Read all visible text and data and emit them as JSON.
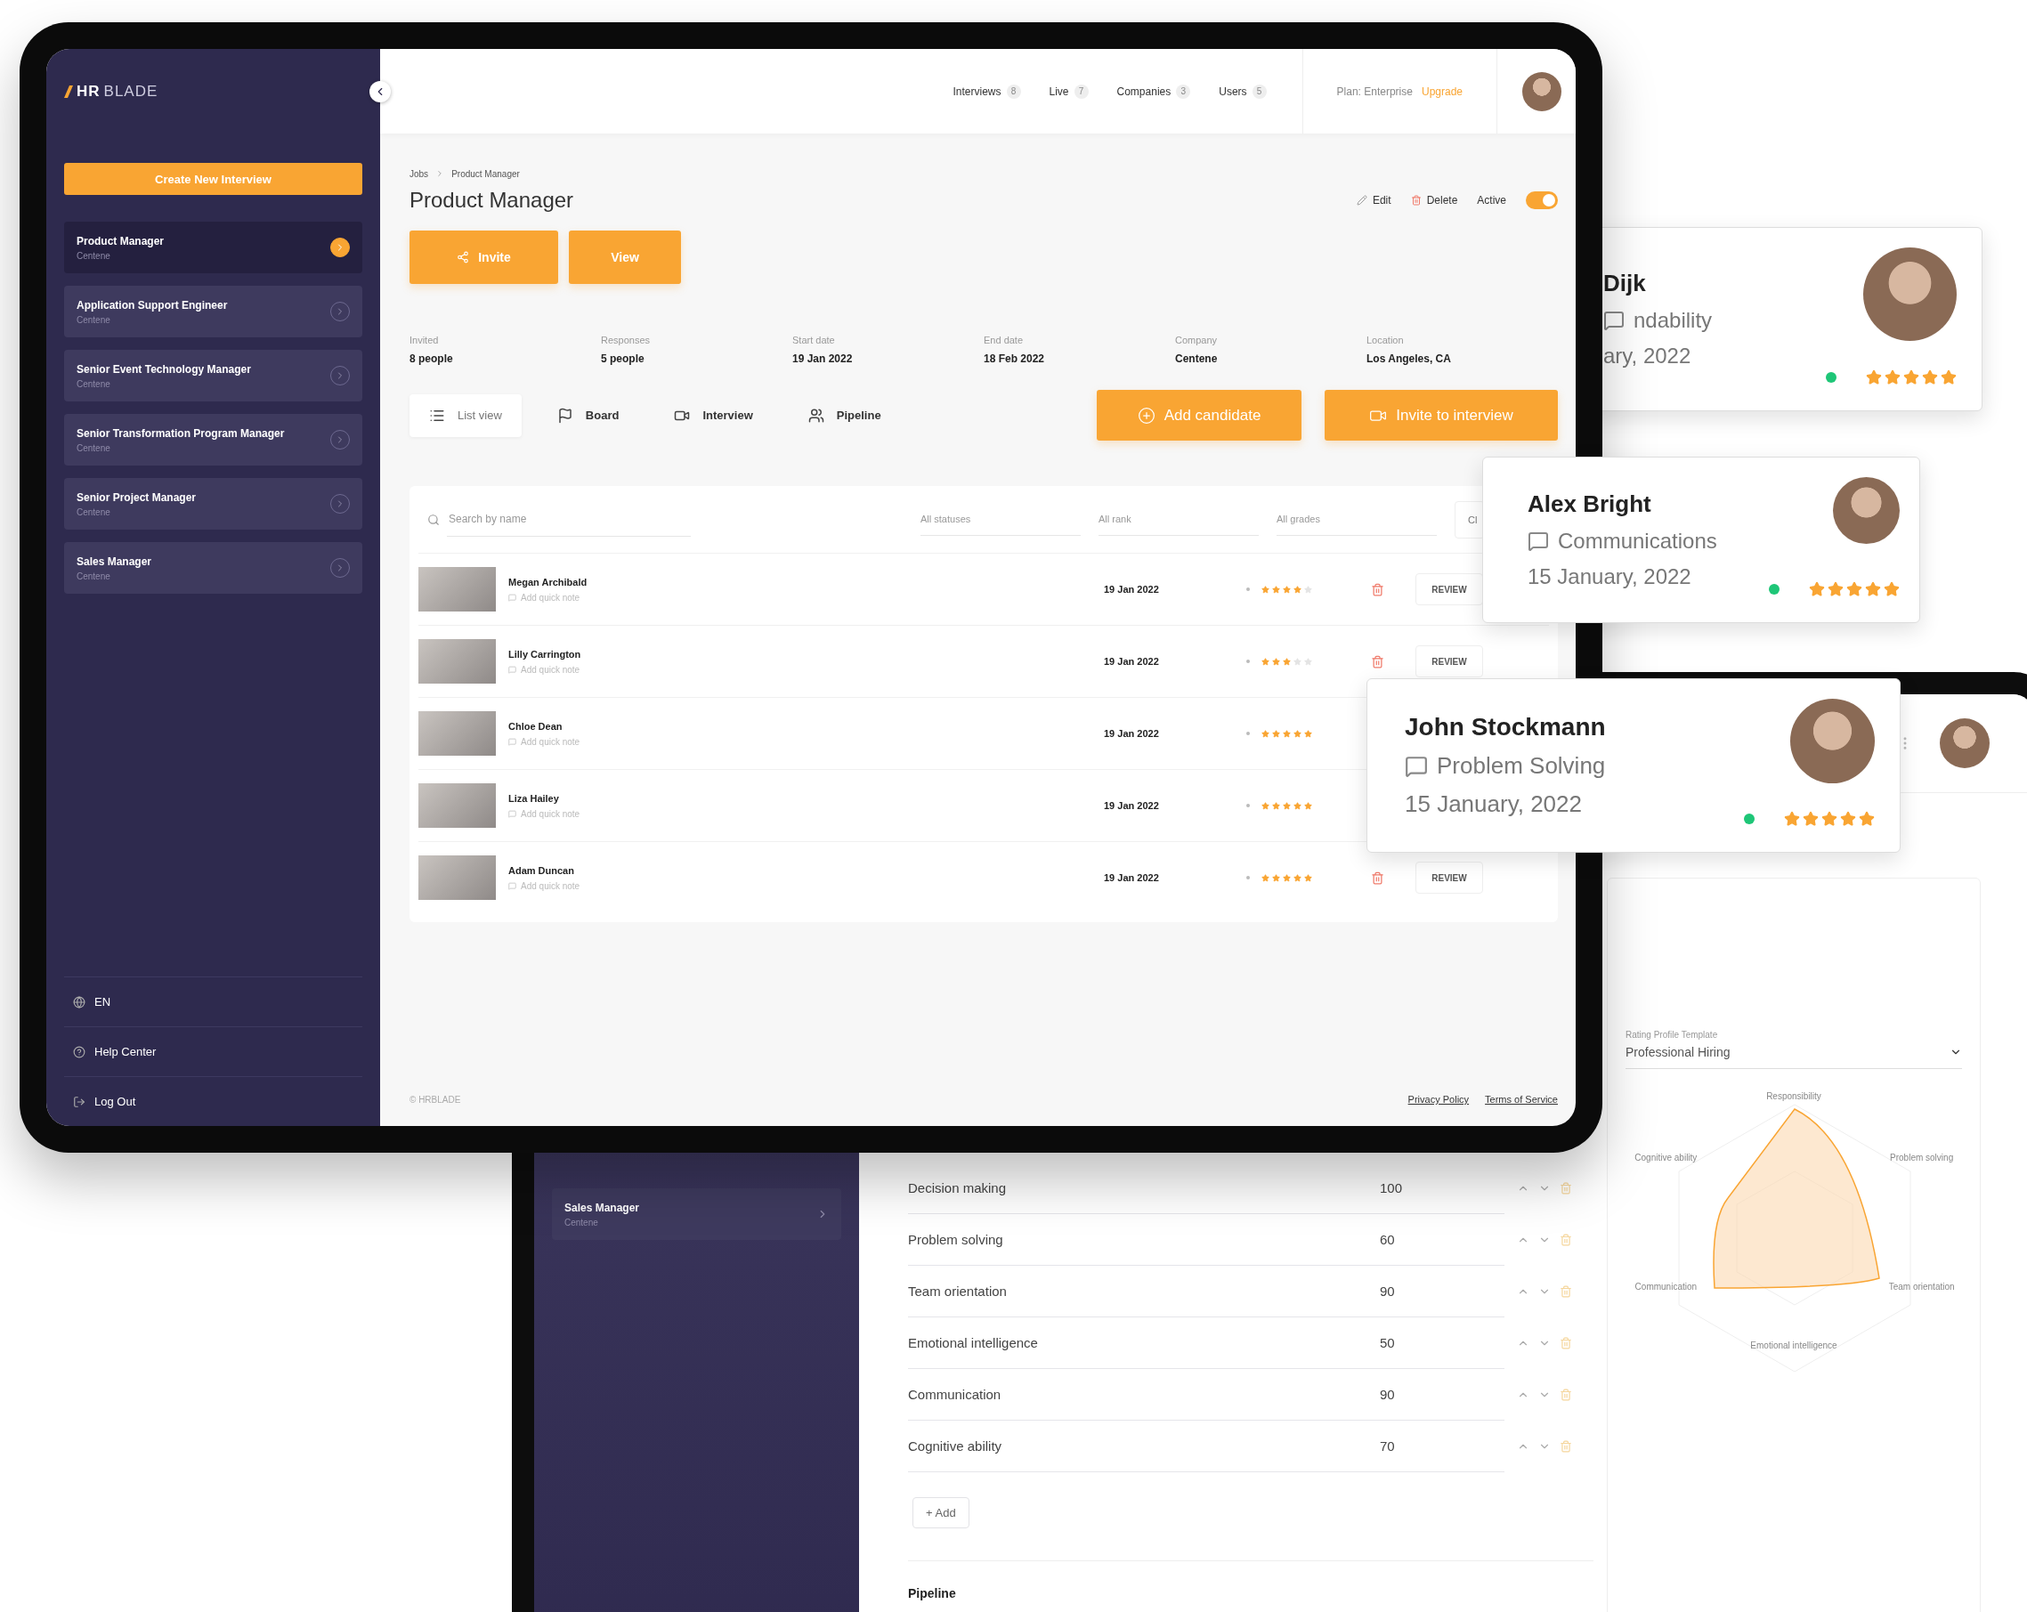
{
  "back": {
    "sidebar_items": [
      {
        "title": "Sales Manager",
        "subtitle": "Centene"
      }
    ],
    "skills": [
      {
        "name": "Decision making",
        "value": "100"
      },
      {
        "name": "Problem solving",
        "value": "60"
      },
      {
        "name": "Team orientation",
        "value": "90"
      },
      {
        "name": "Emotional intelligence",
        "value": "50"
      },
      {
        "name": "Communication",
        "value": "90"
      },
      {
        "name": "Cognitive ability",
        "value": "70"
      }
    ],
    "add_button": "+ Add",
    "section_title": "Pipeline",
    "template": {
      "label": "Rating Profile Template",
      "value": "Professional Hiring"
    },
    "radar_labels": [
      "Responsibility",
      "Problem solving",
      "Team orientation",
      "Emotional intelligence",
      "Communication",
      "Cognitive ability"
    ]
  },
  "front": {
    "sidebar": {
      "logo_bold": "HR",
      "logo_light": "BLADE",
      "create_button": "Create New Interview",
      "items": [
        {
          "title": "Product Manager",
          "subtitle": "Centene",
          "selected": true
        },
        {
          "title": "Application Support Engineer",
          "subtitle": "Centene",
          "selected": false
        },
        {
          "title": "Senior Event Technology Manager",
          "subtitle": "Centene",
          "selected": false
        },
        {
          "title": "Senior Transformation Program Manager",
          "subtitle": "Centene",
          "selected": false
        },
        {
          "title": "Senior Project Manager",
          "subtitle": "Centene",
          "selected": false
        },
        {
          "title": "Sales Manager",
          "subtitle": "Centene",
          "selected": false
        }
      ],
      "footer_items": [
        {
          "kind": "language",
          "label": "EN"
        },
        {
          "kind": "help",
          "label": "Help Center"
        },
        {
          "kind": "logout",
          "label": "Log Out"
        }
      ]
    },
    "top_nav": {
      "links": [
        {
          "label": "Interviews",
          "count": "8"
        },
        {
          "label": "Live",
          "count": "7"
        },
        {
          "label": "Companies",
          "count": "3"
        },
        {
          "label": "Users",
          "count": "5"
        }
      ],
      "plan": "Plan: Enterprise",
      "upgrade": "Upgrade"
    },
    "breadcrumb": [
      "Jobs",
      "Product Manager"
    ],
    "title": "Product Manager",
    "header_buttons": [
      {
        "kind": "invite",
        "label": "Invite"
      },
      {
        "kind": "view",
        "label": "View"
      }
    ],
    "header_actions": [
      {
        "kind": "edit",
        "label": "Edit"
      },
      {
        "kind": "delete",
        "label": "Delete"
      }
    ],
    "active_toggle": {
      "label": "Active",
      "on": true
    },
    "stats": [
      {
        "label": "Invited",
        "value": "8 people"
      },
      {
        "label": "Responses",
        "value": "5 people"
      },
      {
        "label": "Start date",
        "value": "19 Jan 2022"
      },
      {
        "label": "End date",
        "value": "18 Feb 2022"
      },
      {
        "label": "Company",
        "value": "Centene"
      },
      {
        "label": "Location",
        "value": "Los Angeles, CA"
      }
    ],
    "view_tabs": [
      {
        "kind": "list",
        "label": "List view",
        "selected": true
      },
      {
        "kind": "board",
        "label": "Board",
        "selected": false
      },
      {
        "kind": "interview",
        "label": "Interview",
        "selected": false
      },
      {
        "kind": "pipeline",
        "label": "Pipeline",
        "selected": false
      }
    ],
    "action_buttons": [
      {
        "kind": "add",
        "label": "Add candidate"
      },
      {
        "kind": "invite",
        "label": "Invite to interview"
      }
    ],
    "filters": {
      "search_placeholder": "Search by name",
      "selects": [
        "All statuses",
        "All rank",
        "All grades"
      ],
      "clear": "Cl"
    },
    "candidates": [
      {
        "name": "Megan Archibald",
        "note": "Add quick note",
        "date": "19 Jan 2022",
        "stars": 4,
        "review": "REVIEW"
      },
      {
        "name": "Lilly Carrington",
        "note": "Add quick note",
        "date": "19 Jan 2022",
        "stars": 3,
        "review": "REVIEW"
      },
      {
        "name": "Chloe Dean",
        "note": "Add quick note",
        "date": "19 Jan 2022",
        "stars": 5
      },
      {
        "name": "Liza Hailey",
        "note": "Add quick note",
        "date": "19 Jan 2022",
        "stars": 5
      },
      {
        "name": "Adam Duncan",
        "note": "Add quick note",
        "date": "19 Jan 2022",
        "stars": 5,
        "review": "REVIEW"
      }
    ],
    "footer": {
      "copyright": "© HRBLADE",
      "links": [
        "Privacy Policy",
        "Terms of Service"
      ]
    }
  },
  "review_cards": [
    {
      "name": "Dijk",
      "skill": "ndability",
      "date": "ary, 2022",
      "stars": 5
    },
    {
      "name": "Alex Bright",
      "skill": "Communications",
      "date": "15 January, 2022",
      "stars": 5
    },
    {
      "name": "John Stockmann",
      "skill": "Problem Solving",
      "date": "15 January, 2022",
      "stars": 5
    }
  ]
}
